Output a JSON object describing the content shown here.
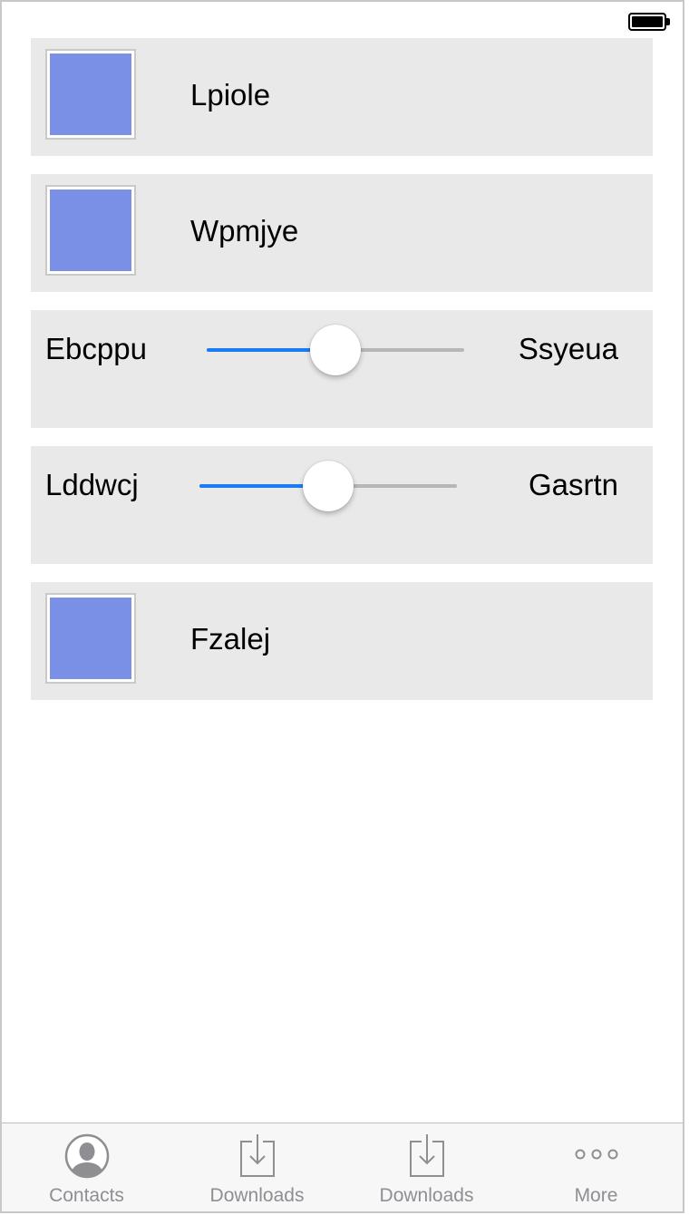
{
  "status_bar": {
    "battery_icon": "battery-full-icon"
  },
  "rows": [
    {
      "kind": "image",
      "label": "Lpiole",
      "image_color": "#7a8fe6"
    },
    {
      "kind": "image",
      "label": "Wpmjye",
      "image_color": "#7a8fe6"
    },
    {
      "kind": "slider",
      "min_label": "Ebcppu",
      "max_label": "Ssyeua",
      "value_fraction": 0.5
    },
    {
      "kind": "slider",
      "min_label": "Lddwcj",
      "max_label": "Gasrtn",
      "value_fraction": 0.5
    },
    {
      "kind": "image",
      "label": "Fzalej",
      "image_color": "#7a8fe6"
    }
  ],
  "tab_bar": {
    "items": [
      {
        "label": "Contacts",
        "icon": "contact-icon"
      },
      {
        "label": "Downloads",
        "icon": "download-icon"
      },
      {
        "label": "Downloads",
        "icon": "download-icon"
      },
      {
        "label": "More",
        "icon": "more-icon"
      }
    ]
  },
  "colors": {
    "accent": "#1a7cf5",
    "row_background": "#e9e9e9",
    "tab_label": "#8e8e93"
  }
}
